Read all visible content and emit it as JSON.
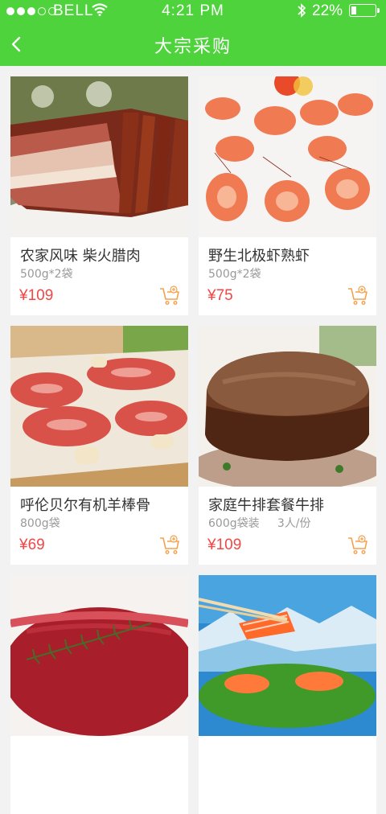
{
  "status_bar": {
    "carrier": "BELL",
    "time": "4:21 PM",
    "battery": "22%",
    "battery_level": 0.22
  },
  "nav": {
    "title": "大宗采购"
  },
  "products": [
    {
      "name": "农家风味 柴火腊肉",
      "spec": "500g*2袋",
      "price": "¥109",
      "image": "smoked-pork"
    },
    {
      "name": "野生北极虾熟虾",
      "spec": "500g*2袋",
      "price": "¥75",
      "image": "shrimp"
    },
    {
      "name": "呼伦贝尔有机羊棒骨",
      "spec": "800g袋",
      "price": "¥69",
      "image": "lamb-bones"
    },
    {
      "name": "家庭牛排套餐牛排",
      "spec": "600g袋装     3人/份",
      "price": "¥109",
      "image": "steak"
    },
    {
      "name": "",
      "spec": "",
      "price": "",
      "image": "raw-beef"
    },
    {
      "name": "",
      "spec": "",
      "price": "",
      "image": "salmon"
    }
  ],
  "colors": {
    "brand": "#4fd33c",
    "price": "#f04747",
    "cart": "#f5a04a"
  }
}
